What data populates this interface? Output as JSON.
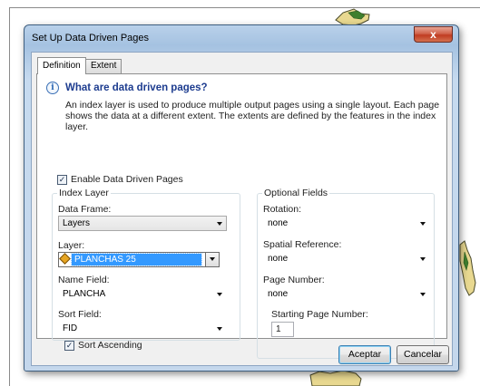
{
  "window": {
    "title": "Set Up Data Driven Pages",
    "close_label": "x"
  },
  "tabs": [
    {
      "label": "Definition",
      "active": true
    },
    {
      "label": "Extent",
      "active": false
    }
  ],
  "info": {
    "icon": "info-icon",
    "icon_glyph": "i",
    "title": "What are data driven pages?",
    "description": "An index layer is used to produce multiple output pages using a single layout.  Each page shows the data at a different extent.  The extents are defined by the features in the index layer."
  },
  "enable_ddp": {
    "label": "Enable Data Driven Pages",
    "checked": true,
    "check_glyph": "✓"
  },
  "index_layer": {
    "legend": "Index Layer",
    "data_frame": {
      "label": "Data Frame:",
      "value": "Layers"
    },
    "layer": {
      "label": "Layer:",
      "value": "PLANCHAS 25"
    },
    "name_field": {
      "label": "Name Field:",
      "value": "PLANCHA"
    },
    "sort_field": {
      "label": "Sort Field:",
      "value": "FID"
    },
    "sort_ascending": {
      "label": "Sort Ascending",
      "checked": true,
      "check_glyph": "✓"
    }
  },
  "optional_fields": {
    "legend": "Optional Fields",
    "rotation": {
      "label": "Rotation:",
      "value": "none"
    },
    "spatial_reference": {
      "label": "Spatial Reference:",
      "value": "none"
    },
    "page_number": {
      "label": "Page Number:",
      "value": "none"
    },
    "starting_page_number": {
      "label": "Starting Page Number:",
      "value": "1"
    }
  },
  "buttons": {
    "ok": "Aceptar",
    "cancel": "Cancelar"
  },
  "colors": {
    "title_accent": "#1d3c8f",
    "selection": "#3399ff",
    "close_button": "#c03c22",
    "map_polygon": "#e8d890",
    "map_green": "#3f7f2e"
  }
}
